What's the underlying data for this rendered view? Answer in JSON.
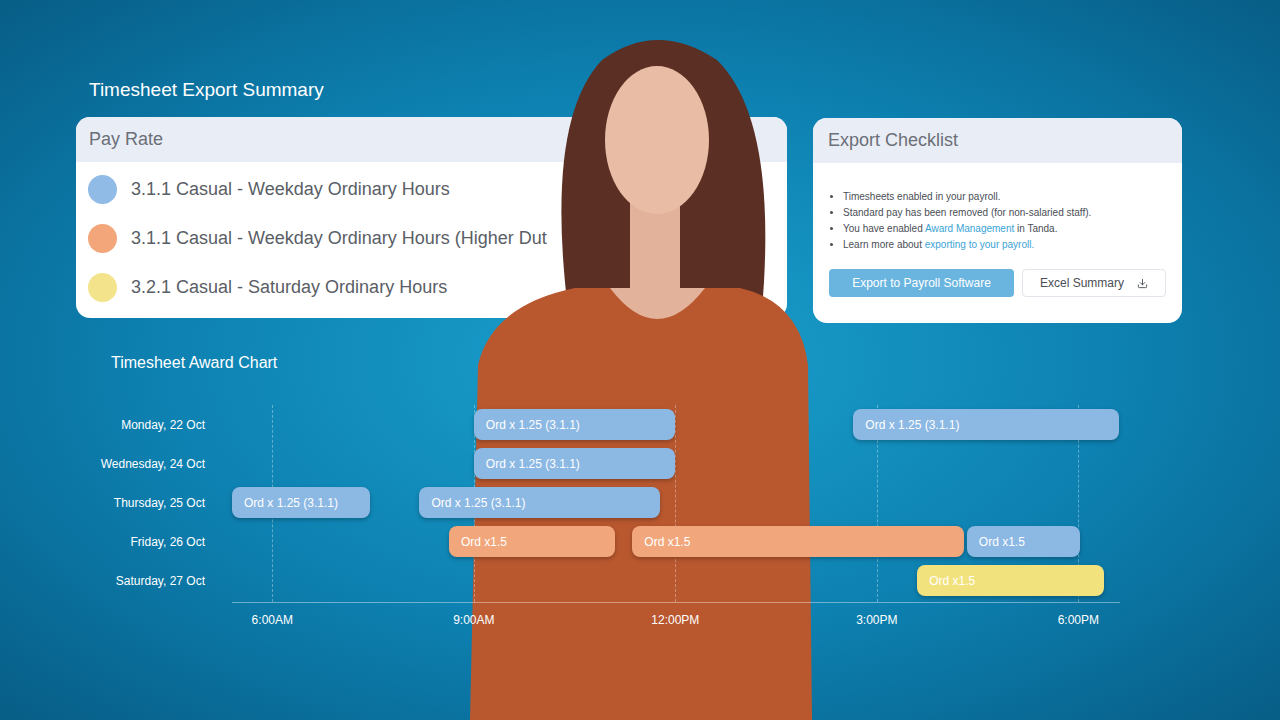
{
  "summary": {
    "title": "Timesheet Export Summary",
    "pay_rate": {
      "header": "Pay Rate",
      "items": [
        {
          "label": "3.1.1 Casual - Weekday Ordinary Hours",
          "color": "#8fbbe6"
        },
        {
          "label": "3.1.1 Casual - Weekday Ordinary Hours (Higher Dut",
          "color": "#f2a679"
        },
        {
          "label": "3.2.1 Casual - Saturday Ordinary Hours",
          "color": "#f3e48c"
        }
      ]
    }
  },
  "checklist": {
    "title": "Export Checklist",
    "items": [
      {
        "before": "Timesheets enabled in your payroll.",
        "link": "",
        "after": ""
      },
      {
        "before": "Standard pay has been removed (for non-salaried staff).",
        "link": "",
        "after": ""
      },
      {
        "before": "You have enabled ",
        "link": "Award Management",
        "after": " in Tanda."
      },
      {
        "before": "Learn more about ",
        "link": "exporting to your payroll.",
        "after": ""
      }
    ],
    "buttons": [
      {
        "label": "Export to Payroll Software",
        "primary": true
      },
      {
        "label": "Excel Summary",
        "primary": false
      }
    ]
  },
  "chart": {
    "title": "Timesheet Award Chart",
    "axis": {
      "min": 5.4,
      "max": 18.62,
      "ticks": [
        {
          "label": "6:00AM",
          "value": 6
        },
        {
          "label": "9:00AM",
          "value": 9
        },
        {
          "label": "12:00PM",
          "value": 12
        },
        {
          "label": "3:00PM",
          "value": 15
        },
        {
          "label": "6:00PM",
          "value": 18
        }
      ]
    },
    "rows": [
      {
        "day": "Monday, 22 Oct",
        "shifts": [
          {
            "label": "Ord x 1.25 (3.1.1)",
            "values": [
              9,
              12
            ],
            "color": "#8cb8e4"
          },
          {
            "label": "Ord x 1.25 (3.1.1)",
            "values": [
              14.65,
              18.6
            ],
            "color": "#8cb8e4"
          }
        ]
      },
      {
        "day": "Wednesday, 24 Oct",
        "shifts": [
          {
            "label": "Ord x 1.25 (3.1.1)",
            "values": [
              9,
              12
            ],
            "color": "#8cb8e4"
          }
        ]
      },
      {
        "day": "Thursday, 25 Oct",
        "shifts": [
          {
            "label": "Ord x 1.25 (3.1.1)",
            "values": [
              5.4,
              7.46
            ],
            "color": "#8cb8e4"
          },
          {
            "label": "Ord x 1.25 (3.1.1)",
            "values": [
              8.19,
              11.77
            ],
            "color": "#8cb8e4"
          }
        ]
      },
      {
        "day": "Friday, 26 Oct",
        "shifts": [
          {
            "label": "Ord x1.5",
            "values": [
              8.63,
              11.1
            ],
            "color": "#f1a77b"
          },
          {
            "label": "Ord x1.5",
            "values": [
              11.36,
              16.3
            ],
            "color": "#f1a77b"
          },
          {
            "label": "Ord x1.5",
            "values": [
              16.34,
              18.02
            ],
            "color": "#8cb8e4"
          }
        ]
      },
      {
        "day": "Saturday, 27 Oct",
        "shifts": [
          {
            "label": "Ord x1.5",
            "values": [
              15.6,
              18.38
            ],
            "color": "#f2e27e"
          }
        ]
      }
    ]
  }
}
